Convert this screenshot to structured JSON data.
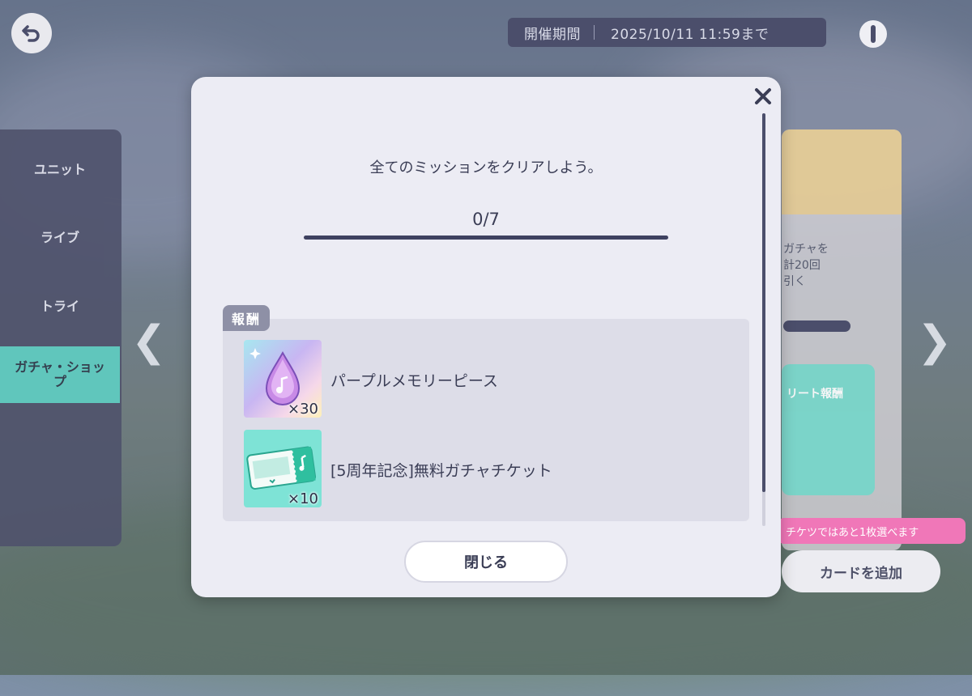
{
  "header": {
    "period_label": "開催期間",
    "period_value": "2025/10/11 11:59まで"
  },
  "sidebar": {
    "items": [
      {
        "label": "ユニット"
      },
      {
        "label": "ライブ"
      },
      {
        "label": "トライ"
      },
      {
        "label": "ガチャ・ショップ"
      }
    ]
  },
  "background_card": {
    "text_lines": [
      "ガチャを",
      "計20回",
      "引く"
    ],
    "banner_text": "リート報酬",
    "notice_text": "チケツではあと1枚選べます",
    "add_card_label": "カードを追加"
  },
  "modal": {
    "description": "全てのミッションをクリアしよう。",
    "progress_text": "0/7",
    "progress": {
      "current": 0,
      "total": 7
    },
    "reward_label": "報酬",
    "rewards": [
      {
        "name": "パープルメモリーピース",
        "quantity": "×30",
        "icon": "purple-memory-piece-icon"
      },
      {
        "name": "[5周年記念]無料ガチャチケット",
        "quantity": "×10",
        "icon": "gacha-ticket-icon"
      }
    ],
    "close_label": "閉じる"
  },
  "colors": {
    "accent": "#6fd7c9",
    "dark": "#4b4e6b",
    "modal_bg": "#ececf4"
  }
}
